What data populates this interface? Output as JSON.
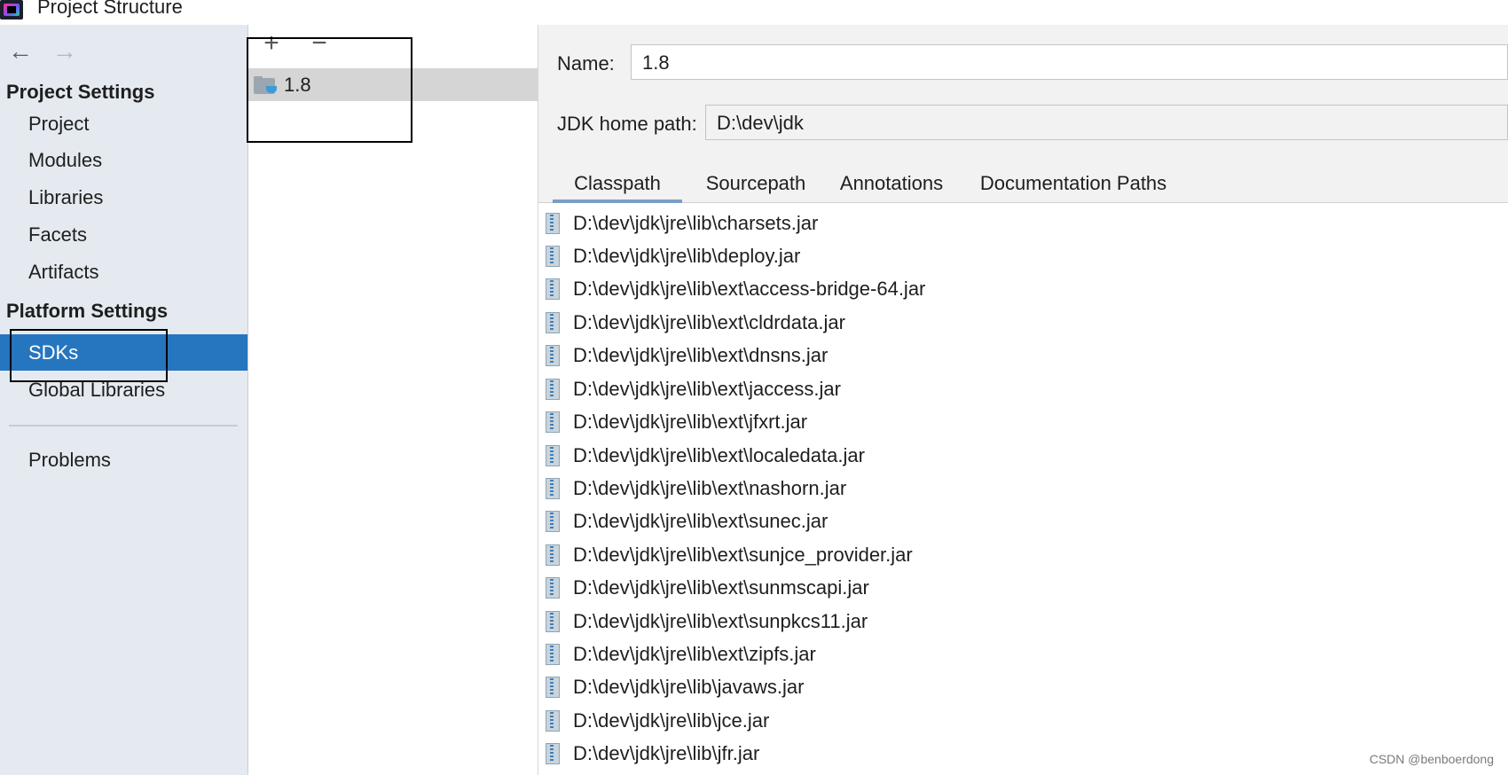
{
  "window": {
    "title": "Project Structure"
  },
  "sidebar": {
    "project_settings_header": "Project Settings",
    "project_items": [
      {
        "label": "Project"
      },
      {
        "label": "Modules"
      },
      {
        "label": "Libraries"
      },
      {
        "label": "Facets"
      },
      {
        "label": "Artifacts"
      }
    ],
    "platform_settings_header": "Platform Settings",
    "platform_items": [
      {
        "label": "SDKs",
        "selected": true
      },
      {
        "label": "Global Libraries"
      }
    ],
    "problems_label": "Problems"
  },
  "sdk_list": {
    "toolbar": {
      "add": "+",
      "remove": "−"
    },
    "items": [
      {
        "label": "1.8",
        "selected": true
      }
    ]
  },
  "detail": {
    "name_label": "Name:",
    "name_value": "1.8",
    "jdk_home_label": "JDK home path:",
    "jdk_home_value": "D:\\dev\\jdk",
    "tabs": [
      {
        "label": "Classpath",
        "active": true
      },
      {
        "label": "Sourcepath"
      },
      {
        "label": "Annotations"
      },
      {
        "label": "Documentation Paths"
      }
    ],
    "classpath": [
      "D:\\dev\\jdk\\jre\\lib\\charsets.jar",
      "D:\\dev\\jdk\\jre\\lib\\deploy.jar",
      "D:\\dev\\jdk\\jre\\lib\\ext\\access-bridge-64.jar",
      "D:\\dev\\jdk\\jre\\lib\\ext\\cldrdata.jar",
      "D:\\dev\\jdk\\jre\\lib\\ext\\dnsns.jar",
      "D:\\dev\\jdk\\jre\\lib\\ext\\jaccess.jar",
      "D:\\dev\\jdk\\jre\\lib\\ext\\jfxrt.jar",
      "D:\\dev\\jdk\\jre\\lib\\ext\\localedata.jar",
      "D:\\dev\\jdk\\jre\\lib\\ext\\nashorn.jar",
      "D:\\dev\\jdk\\jre\\lib\\ext\\sunec.jar",
      "D:\\dev\\jdk\\jre\\lib\\ext\\sunjce_provider.jar",
      "D:\\dev\\jdk\\jre\\lib\\ext\\sunmscapi.jar",
      "D:\\dev\\jdk\\jre\\lib\\ext\\sunpkcs11.jar",
      "D:\\dev\\jdk\\jre\\lib\\ext\\zipfs.jar",
      "D:\\dev\\jdk\\jre\\lib\\javaws.jar",
      "D:\\dev\\jdk\\jre\\lib\\jce.jar",
      "D:\\dev\\jdk\\jre\\lib\\jfr.jar"
    ]
  },
  "watermark": "CSDN @benboerdong",
  "colors": {
    "selection": "#2675bf",
    "sidebar_bg": "#e4eaf0",
    "list_selected_bg": "#d5d5d5",
    "tab_underline": "#7a9ec4"
  },
  "icons": [
    "app-logo-icon",
    "back-arrow-icon",
    "forward-arrow-icon",
    "add-icon",
    "remove-icon",
    "jdk-folder-icon",
    "jar-icon"
  ]
}
